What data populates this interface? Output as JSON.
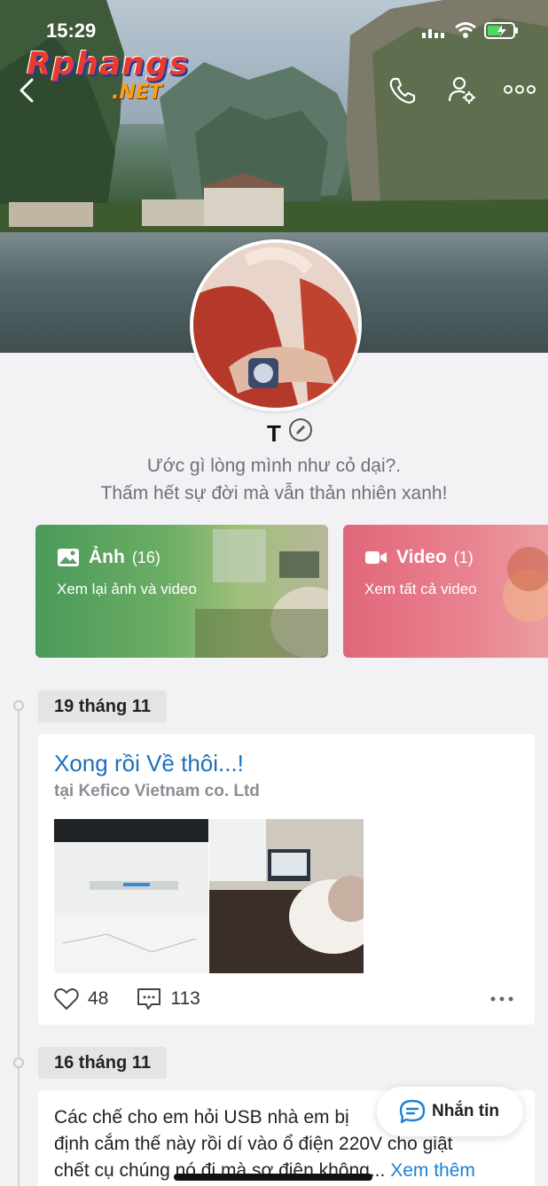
{
  "status_bar": {
    "time": "15:29"
  },
  "watermark": {
    "brand": "Rphangs",
    "suffix": ".NET"
  },
  "profile": {
    "name": "T",
    "bio_line1": "Ước gì lòng mình như cỏ dại?.",
    "bio_line2": "Thấm hết sự đời mà vẫn thản nhiên xanh!"
  },
  "media": {
    "photos": {
      "label": "Ảnh",
      "count": "(16)",
      "subtitle": "Xem lại ảnh và video"
    },
    "videos": {
      "label": "Video",
      "count": "(1)",
      "subtitle": "Xem tất cả video"
    }
  },
  "timeline": [
    {
      "date": "19 tháng 11",
      "title": "Xong rồi Về thôi...!",
      "location": "tại Kefico Vietnam co. Ltd",
      "likes": "48",
      "comments": "113"
    },
    {
      "date": "16 tháng 11",
      "text_line1": "Các chế cho em hỏi USB nhà em bị",
      "text_line2": "định cắm thế này rồi dí vào ổ điện 220V  cho giật",
      "text_line3": "chết cụ chúng nó đi mà sợ điện không...",
      "see_more": "Xem thêm"
    }
  ],
  "chat_button": {
    "label": "Nhắn tin"
  },
  "colors": {
    "link": "#1e6fb8",
    "photo_card": "#4a9a5a",
    "video_card": "#e0677a"
  }
}
